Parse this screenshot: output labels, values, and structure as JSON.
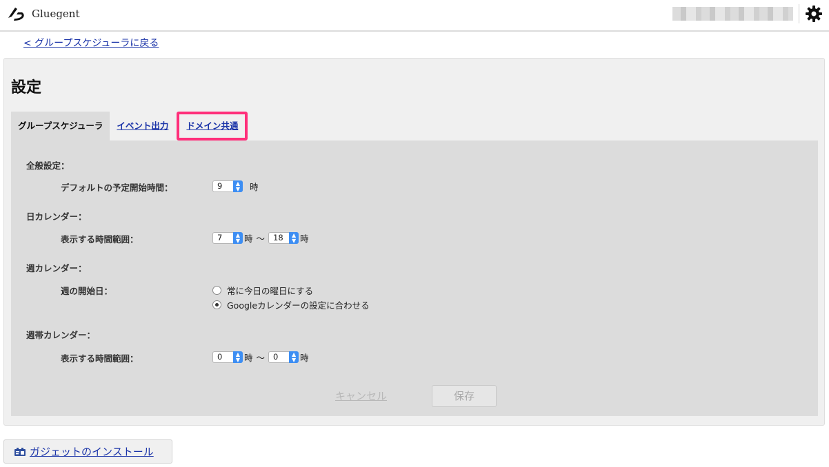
{
  "header": {
    "app_name": "Gluegent",
    "logo_icon": "gluegent-logo-icon",
    "settings_icon": "gear-icon"
  },
  "back_link": "< グループスケジューラに戻る",
  "page": {
    "title": "設定",
    "tabs": [
      {
        "label": "グループスケジューラ",
        "state": "active"
      },
      {
        "label": "イベント出力",
        "state": "link"
      },
      {
        "label": "ドメイン共通",
        "state": "link-highlighted"
      }
    ]
  },
  "general": {
    "section_label": "全般設定：",
    "default_start_label": "デフォルトの予定開始時間：",
    "default_start_value": "9",
    "hour_unit": "時"
  },
  "day_calendar": {
    "section_label": "日カレンダー：",
    "range_label": "表示する時間範囲：",
    "from_value": "7",
    "to_value": "18",
    "hour_unit": "時",
    "separator": "〜"
  },
  "week_calendar": {
    "section_label": "週カレンダー：",
    "week_start_label": "週の開始日：",
    "options": [
      {
        "label": "常に今日の曜日にする",
        "checked": false
      },
      {
        "label": "Googleカレンダーの設定に合わせる",
        "checked": true
      }
    ]
  },
  "weekband_calendar": {
    "section_label": "週帯カレンダー：",
    "range_label": "表示する時間範囲：",
    "from_value": "0",
    "to_value": "0",
    "hour_unit": "時",
    "separator": "〜"
  },
  "actions": {
    "cancel_label": "キャンセル",
    "save_label": "保存"
  },
  "gadget": {
    "install_label": "ガジェットのインストール",
    "icon": "gadget-icon"
  },
  "colors": {
    "link": "#1a33a8",
    "highlight_border": "#ff2f7a",
    "select_arrow": "#3d8ef3"
  }
}
